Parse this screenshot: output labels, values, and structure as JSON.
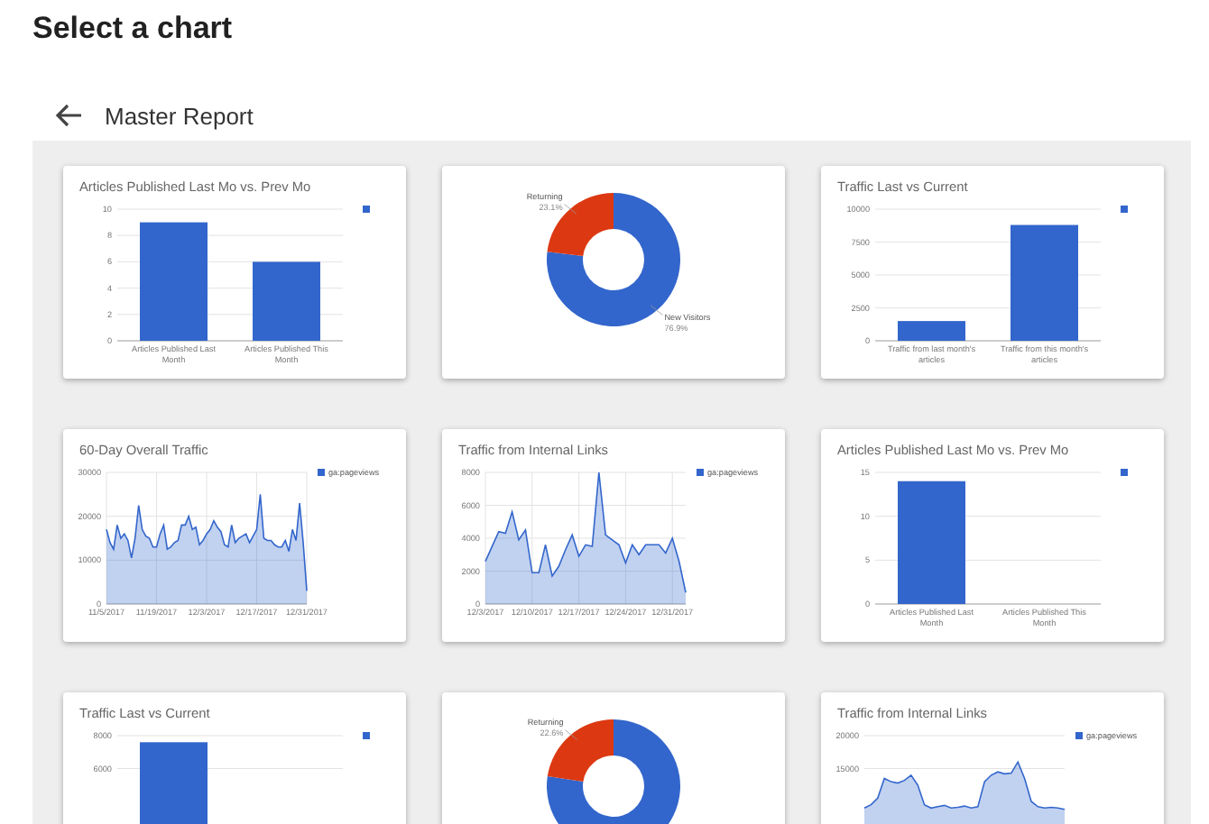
{
  "title": "Select a chart",
  "header": {
    "title": "Master Report"
  },
  "cards": [
    {
      "title": "Articles Published Last Mo vs. Prev Mo",
      "chart_data": {
        "type": "bar",
        "grid": true,
        "categories": [
          "Articles Published Last Month",
          "Articles Published This Month"
        ],
        "series": [
          {
            "color": "#3366cc",
            "values": [
              9,
              6
            ]
          }
        ],
        "ylim": [
          0,
          10
        ],
        "yticks": [
          0,
          2,
          4,
          6,
          8,
          10
        ]
      }
    },
    {
      "chart_data": {
        "type": "donut",
        "categories": [
          "New Visitors",
          "Returning"
        ],
        "values": [
          76.9,
          23.1
        ],
        "value_labels": [
          "76.9%",
          "23.1%"
        ]
      }
    },
    {
      "title": "Traffic Last vs Current",
      "chart_data": {
        "type": "bar",
        "grid": true,
        "categories": [
          "Traffic from last month's articles",
          "Traffic from this month's articles"
        ],
        "series": [
          {
            "color": "#3366cc",
            "values": [
              1500,
              8800
            ]
          }
        ],
        "ylim": [
          0,
          10000
        ],
        "yticks": [
          0,
          2500,
          5000,
          7500,
          10000
        ]
      }
    },
    {
      "title": "60-Day Overall Traffic",
      "chart_data": {
        "type": "area",
        "grid": true,
        "categories": [
          "11/5/2017",
          null,
          null,
          null,
          null,
          null,
          null,
          null,
          null,
          null,
          null,
          null,
          null,
          null,
          "11/19/2017",
          null,
          null,
          null,
          null,
          null,
          null,
          null,
          null,
          null,
          null,
          null,
          null,
          null,
          "12/3/2017",
          null,
          null,
          null,
          null,
          null,
          null,
          null,
          null,
          null,
          null,
          null,
          null,
          null,
          "12/17/2017",
          null,
          null,
          null,
          null,
          null,
          null,
          null,
          null,
          null,
          null,
          null,
          null,
          null,
          "12/31/2017"
        ],
        "ylim": [
          0,
          30000
        ],
        "yticks": [
          0,
          10000,
          20000,
          30000
        ],
        "series": [
          {
            "name": "ga:pageviews",
            "color": "#3366cc",
            "values": [
              17000,
              14000,
              12500,
              18000,
              15000,
              16000,
              14500,
              10500,
              15000,
              22500,
              17000,
              15500,
              15000,
              13000,
              13000,
              16000,
              18000,
              12500,
              13000,
              14000,
              14500,
              18000,
              18000,
              20000,
              17000,
              17500,
              13500,
              14500,
              16000,
              17000,
              19000,
              17500,
              16500,
              13500,
              13000,
              18000,
              14000,
              15000,
              15500,
              16000,
              14000,
              15500,
              17000,
              25000,
              15000,
              14500,
              14500,
              13500,
              13000,
              13000,
              14500,
              12000,
              17000,
              14500,
              23000,
              14000,
              3000
            ]
          }
        ]
      }
    },
    {
      "title": "Traffic from Internal Links",
      "chart_data": {
        "type": "area",
        "grid": true,
        "categories": [
          "12/3/2017",
          null,
          null,
          null,
          null,
          null,
          null,
          "12/10/2017",
          null,
          null,
          null,
          null,
          null,
          null,
          "12/17/2017",
          null,
          null,
          null,
          null,
          null,
          null,
          "12/24/2017",
          null,
          null,
          null,
          null,
          null,
          null,
          "12/31/2017",
          null,
          null
        ],
        "ylim": [
          0,
          8000
        ],
        "yticks": [
          0,
          2000,
          4000,
          6000,
          8000
        ],
        "series": [
          {
            "name": "ga:pageviews",
            "color": "#3366cc",
            "values": [
              2600,
              3500,
              4400,
              4300,
              5600,
              3900,
              4500,
              1900,
              1900,
              3600,
              1700,
              2300,
              3300,
              4200,
              2900,
              3600,
              3500,
              8000,
              4200,
              3900,
              3600,
              2500,
              3600,
              3000,
              3600,
              3600,
              3600,
              3100,
              4000,
              2600,
              700
            ]
          }
        ]
      }
    },
    {
      "title": "Articles Published Last Mo vs. Prev Mo",
      "chart_data": {
        "type": "bar",
        "grid": true,
        "categories": [
          "Articles Published Last Month",
          "Articles Published This Month"
        ],
        "series": [
          {
            "color": "#3366cc",
            "values": [
              14,
              0
            ]
          }
        ],
        "ylim": [
          0,
          15
        ],
        "yticks": [
          0,
          5,
          10,
          15
        ]
      }
    },
    {
      "title": "Traffic Last vs Current",
      "chart_data": {
        "type": "bar",
        "grid": true,
        "series": [
          {
            "color": "#3366cc",
            "values": [
              7600,
              null
            ]
          }
        ],
        "ylim": [
          0,
          8000
        ],
        "yticks": [
          6000,
          8000
        ]
      }
    },
    {
      "chart_data": {
        "type": "donut",
        "categories": [
          null,
          "Returning"
        ],
        "values": [
          77.4,
          22.6
        ],
        "value_labels": [
          null,
          "22.6%"
        ]
      }
    },
    {
      "title": "Traffic from Internal Links",
      "chart_data": {
        "type": "area",
        "grid": true,
        "ylim": [
          0,
          20000
        ],
        "yticks": [
          15000,
          20000
        ],
        "series": [
          {
            "name": "ga:pageviews",
            "color": "#3366cc",
            "values": [
              9000,
              9500,
              10500,
              13500,
              13000,
              12800,
              13200,
              14000,
              12500,
              9500,
              9000,
              9200,
              9400,
              9000,
              9100,
              9300,
              9000,
              9200,
              13000,
              14000,
              14500,
              14200,
              14300,
              16000,
              13500,
              10000,
              9200,
              9000,
              9100,
              9000,
              8800
            ]
          }
        ]
      }
    }
  ]
}
